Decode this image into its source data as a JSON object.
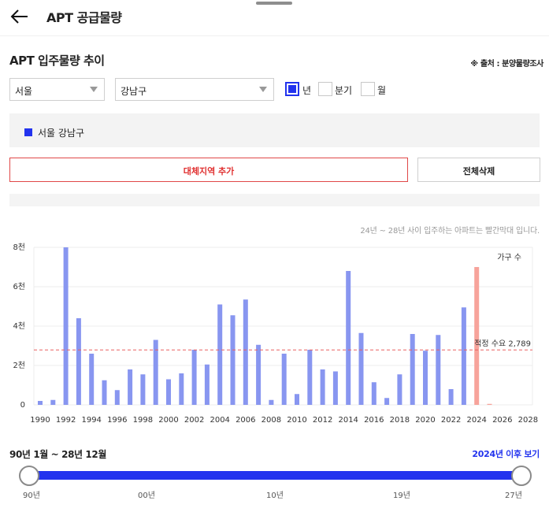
{
  "header": {
    "title": "APT 공급물량"
  },
  "section": {
    "title": "APT 입주물량 추이",
    "source": "※ 출처 : 분양물량조사"
  },
  "filters": {
    "city": "서울",
    "district": "강남구",
    "periods": [
      {
        "label": "년",
        "checked": true
      },
      {
        "label": "분기",
        "checked": false
      },
      {
        "label": "월",
        "checked": false
      }
    ]
  },
  "selected_region": {
    "label": "서울 강남구",
    "color": "#2233ee"
  },
  "buttons": {
    "add_region": "대체지역 추가",
    "delete_all": "전체삭제"
  },
  "note": "24년 ~ 28년 사이 입주하는 아파트는 빨간막대 입니다.",
  "chart_data": {
    "type": "bar",
    "y_unit_label": "가구 수",
    "ylim": [
      0,
      8000
    ],
    "y_ticks": [
      "0",
      "2천",
      "4천",
      "6천",
      "8천"
    ],
    "x_tick_labels": [
      "1990",
      "1992",
      "1994",
      "1996",
      "1998",
      "2000",
      "2002",
      "2004",
      "2006",
      "2008",
      "2010",
      "2012",
      "2014",
      "2016",
      "2018",
      "2020",
      "2022",
      "2024",
      "2026",
      "2028"
    ],
    "x": [
      1990,
      1991,
      1992,
      1993,
      1994,
      1995,
      1996,
      1997,
      1998,
      1999,
      2000,
      2001,
      2002,
      2003,
      2004,
      2005,
      2006,
      2007,
      2008,
      2009,
      2010,
      2011,
      2012,
      2013,
      2014,
      2015,
      2016,
      2017,
      2018,
      2019,
      2020,
      2021,
      2022,
      2023,
      2024,
      2025,
      2026,
      2027,
      2028
    ],
    "values": [
      200,
      250,
      8000,
      4400,
      2600,
      1250,
      750,
      1800,
      1550,
      3300,
      1300,
      1600,
      2800,
      2050,
      5100,
      4550,
      5350,
      3050,
      250,
      2600,
      550,
      2800,
      1800,
      1700,
      6800,
      3650,
      1150,
      350,
      1550,
      3600,
      2750,
      3550,
      800,
      4950,
      7000,
      50,
      0,
      0,
      0
    ],
    "highlight_from": 2024,
    "reference_line": {
      "value": 2789,
      "label": "적정 수요 2,789"
    },
    "colors": {
      "bar": "#8896f0",
      "highlight": "#f7a39b",
      "reference": "#e96060"
    },
    "grid": true
  },
  "range": {
    "label": "90년 1월 ~ 28년 12월",
    "after_link": "2024년 이후 보기",
    "ticks": [
      "90년",
      "00년",
      "10년",
      "19년",
      "27년"
    ],
    "start": 0,
    "end": 1,
    "color": "#2233ee"
  }
}
